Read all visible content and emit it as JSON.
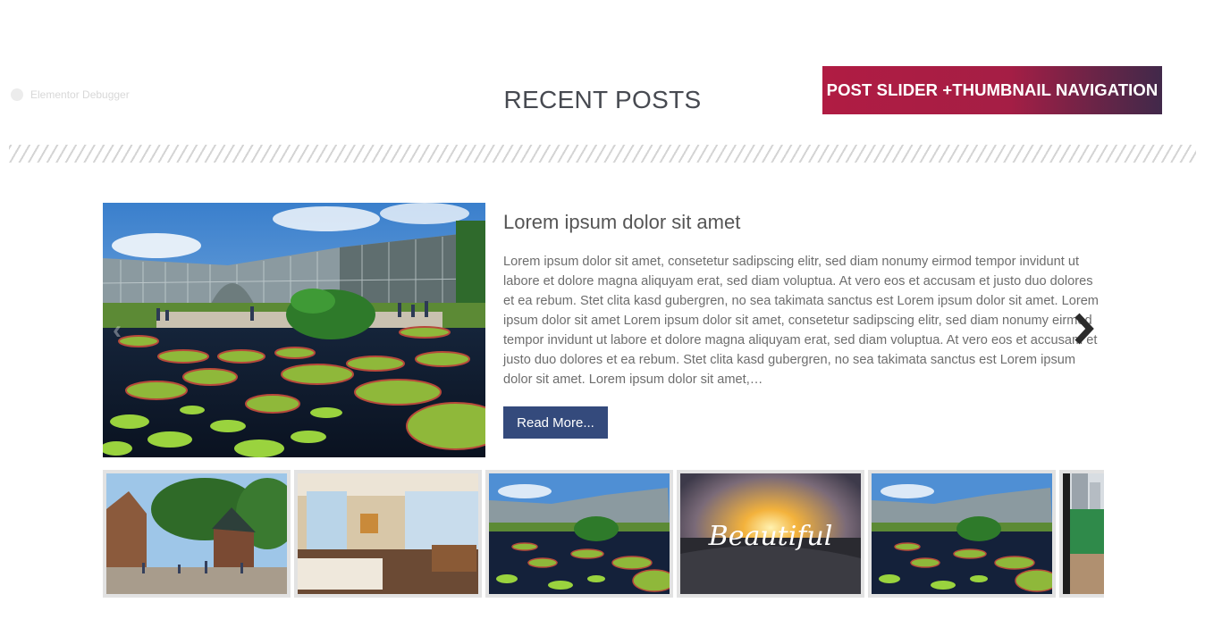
{
  "debugger": {
    "label": "Elementor Debugger"
  },
  "header": {
    "title": "RECENT POSTS",
    "badge": "POST SLIDER +THUMBNAIL NAVIGATION"
  },
  "slide": {
    "title": "Lorem ipsum dolor sit amet",
    "excerpt": "Lorem ipsum dolor sit amet, consetetur sadipscing elitr, sed diam nonumy eirmod tempor invidunt ut labore et dolore magna aliquyam erat, sed diam voluptua. At vero eos et accusam et justo duo dolores et ea rebum. Stet clita kasd gubergren, no sea takimata sanctus est Lorem ipsum dolor sit amet. Lorem ipsum dolor sit amet Lorem ipsum dolor sit amet, consetetur sadipscing elitr, sed diam nonumy eirmod tempor invidunt ut labore et dolore magna aliquyam erat, sed diam voluptua. At vero eos et accusam et justo duo dolores et ea rebum. Stet clita kasd gubergren, no sea takimata sanctus est Lorem ipsum dolor sit amet. Lorem ipsum dolor sit amet,…",
    "read_more": "Read More...",
    "image_icon": "greenhouse-lily-pond-image"
  },
  "thumbnails": {
    "items": [
      {
        "icon": "park-street-image"
      },
      {
        "icon": "hotel-room-image"
      },
      {
        "icon": "greenhouse-lily-pond-image"
      },
      {
        "icon": "sunset-beautiful-image",
        "caption": "Beautiful"
      },
      {
        "icon": "greenhouse-lily-pond-image"
      },
      {
        "icon": "city-partial-image"
      }
    ]
  },
  "colors": {
    "badge_start": "#b01c43",
    "badge_end": "#41294a",
    "button": "#344a7c"
  }
}
